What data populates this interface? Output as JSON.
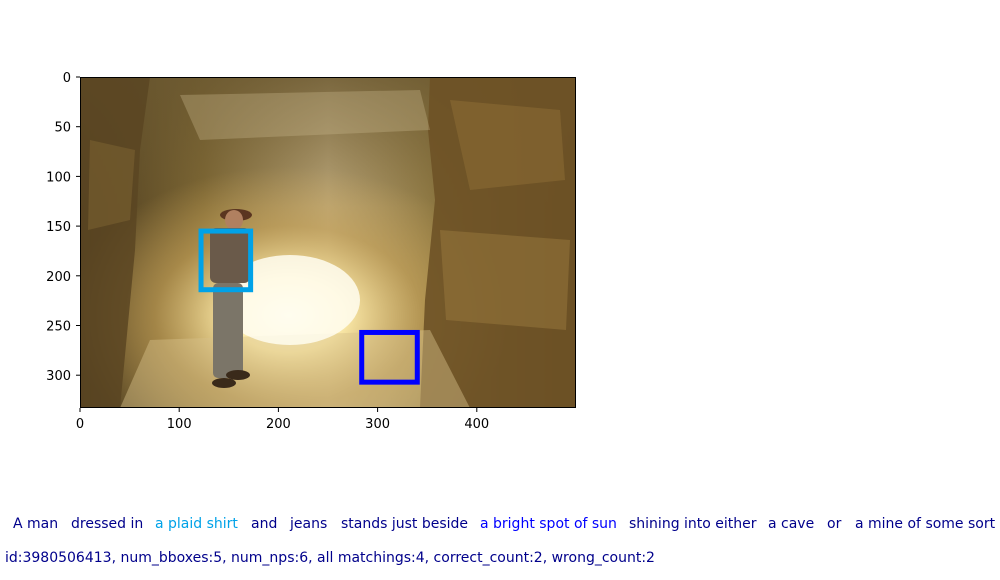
{
  "image_axes": {
    "x_ticks": [
      "0",
      "100",
      "200",
      "300",
      "400"
    ],
    "y_ticks": [
      "0",
      "50",
      "100",
      "150",
      "200",
      "250",
      "300"
    ],
    "xlim": [
      0,
      500
    ],
    "ylim": [
      0,
      333
    ]
  },
  "bboxes": [
    {
      "label": "a plaid shirt",
      "color": "#00a2e8",
      "x0": 122,
      "y0": 155,
      "x1": 172,
      "y1": 214
    },
    {
      "label": "a bright spot of sun",
      "color": "#0000ff",
      "x0": 284,
      "y0": 257,
      "x1": 340,
      "y1": 307
    }
  ],
  "caption": {
    "segments": [
      {
        "text": "A man",
        "color": "#00008b"
      },
      {
        "text": "dressed in",
        "color": "#00008b"
      },
      {
        "text": "a plaid shirt",
        "color": "#00a2e8"
      },
      {
        "text": "and",
        "color": "#00008b"
      },
      {
        "text": "jeans",
        "color": "#00008b"
      },
      {
        "text": "stands just beside",
        "color": "#00008b"
      },
      {
        "text": "a bright spot of sun",
        "color": "#0000ff"
      },
      {
        "text": "shining into either",
        "color": "#00008b"
      },
      {
        "text": "a cave",
        "color": "#00008b"
      },
      {
        "text": "or",
        "color": "#00008b"
      },
      {
        "text": "a mine of some sort",
        "color": "#00008b"
      }
    ]
  },
  "info": "id:3980506413, num_bboxes:5, num_nps:6, all matchings:4, correct_count:2, wrong_count:2"
}
